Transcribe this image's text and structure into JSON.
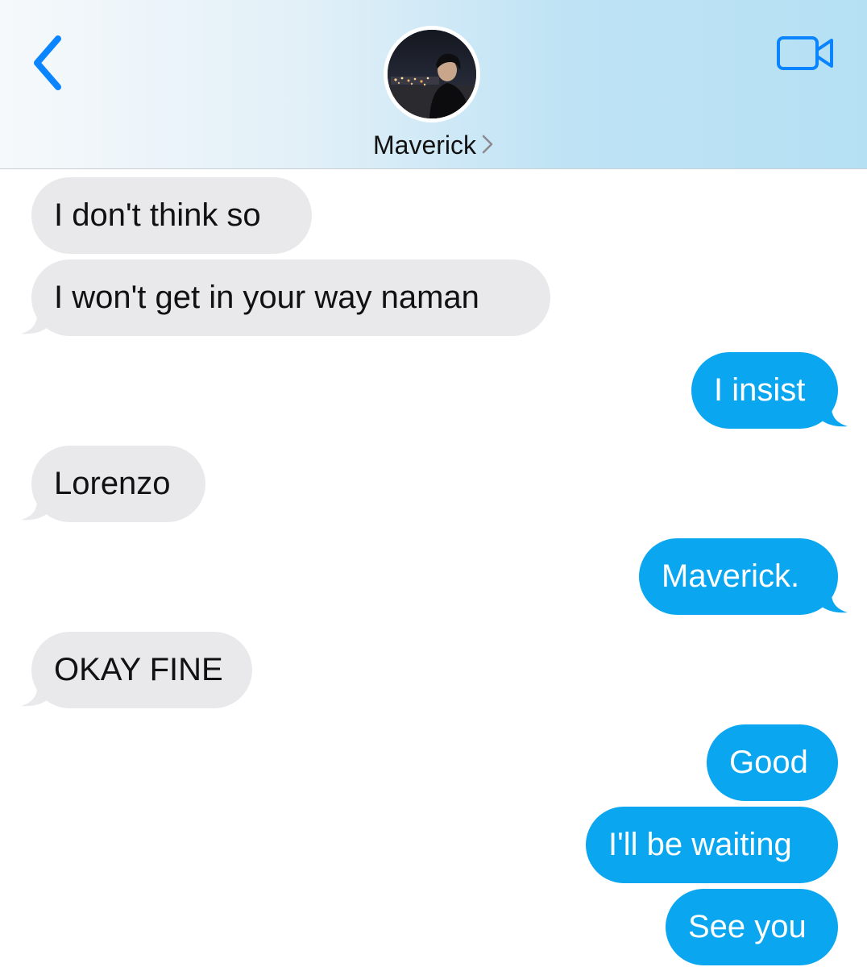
{
  "header": {
    "contact_name": "Maverick",
    "colors": {
      "accent": "#0a84ff",
      "header_gradient_start": "#f6f9fb",
      "header_gradient_end": "#b5e0f4"
    },
    "icons": {
      "back": "chevron-left-icon",
      "video": "video-camera-icon",
      "name_chevron": "chevron-right-icon"
    }
  },
  "messages": [
    {
      "from": "contact",
      "text": "I don't think so"
    },
    {
      "from": "contact",
      "text": "I won't get in your way naman"
    },
    {
      "from": "me",
      "text": "I insist"
    },
    {
      "from": "contact",
      "text": "Lorenzo"
    },
    {
      "from": "me",
      "text": "Maverick."
    },
    {
      "from": "contact",
      "text": "OKAY FINE"
    },
    {
      "from": "me",
      "text": "Good"
    },
    {
      "from": "me",
      "text": "I'll be waiting"
    },
    {
      "from": "me",
      "text": "See you"
    }
  ],
  "colors": {
    "incoming_bubble": "#e9e9eb",
    "outgoing_bubble": "#0aa6f0",
    "incoming_text": "#111111",
    "outgoing_text": "#ffffff"
  }
}
